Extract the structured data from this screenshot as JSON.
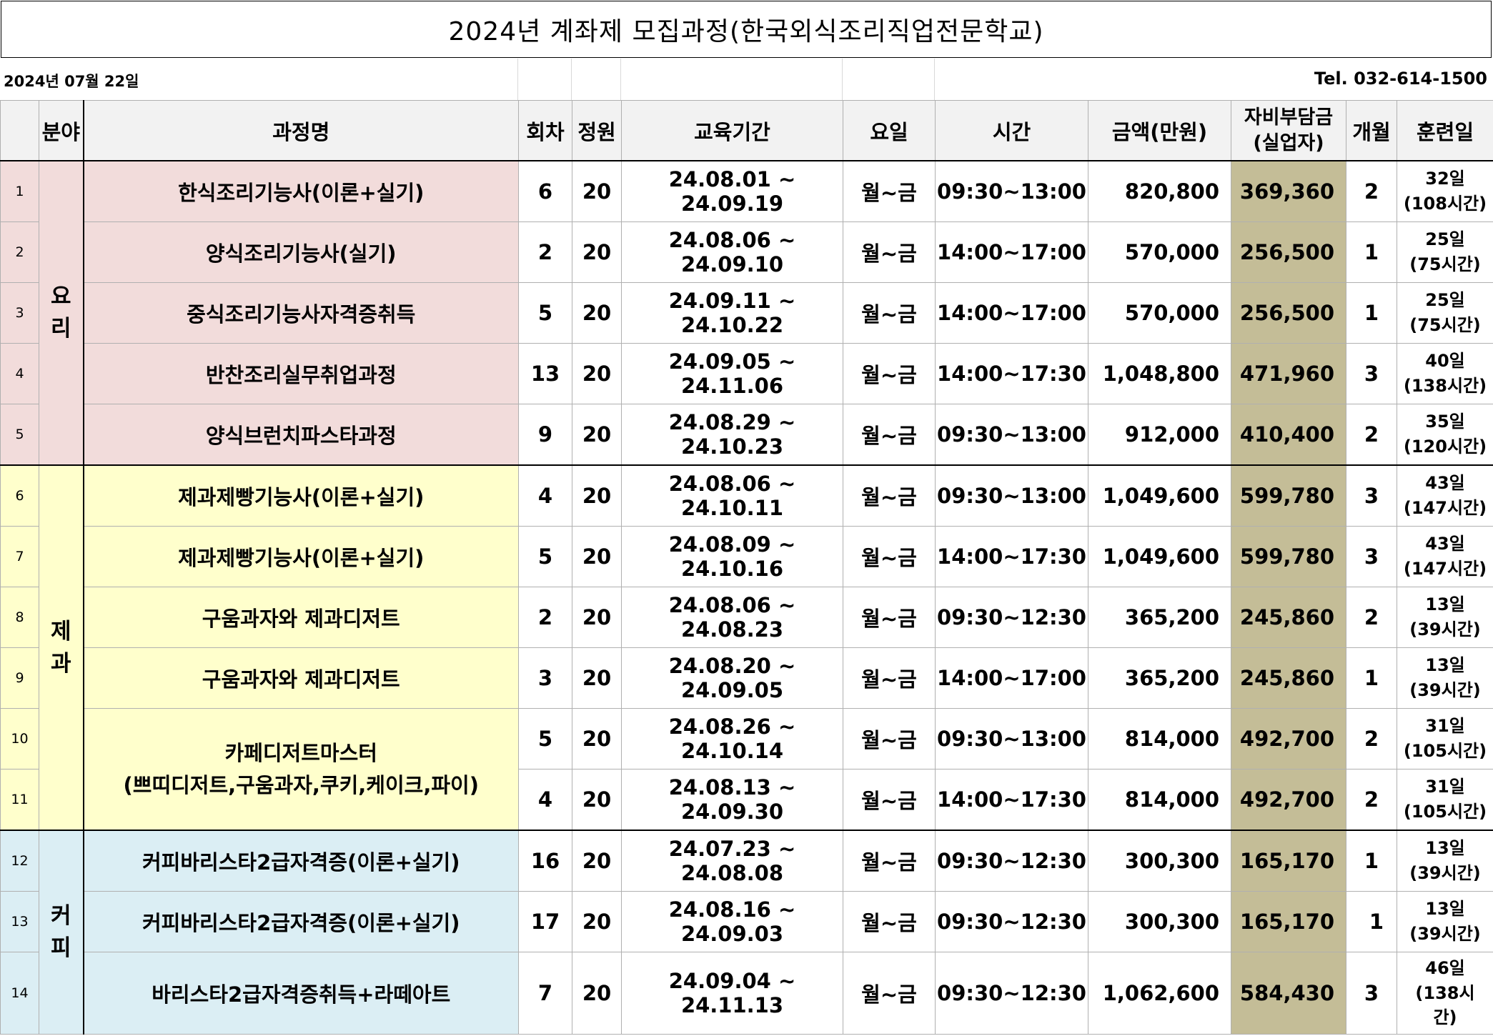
{
  "title": "2024년  계좌제  모집과정(한국외식조리직업전문학교)",
  "date": "2024년 07월 22일",
  "tel": "Tel.  032-614-1500",
  "headers": {
    "category": "분야",
    "course": "과정명",
    "round": "회차",
    "capacity": "정원",
    "period": "교육기간",
    "weekday": "요일",
    "time": "시간",
    "amount": "금액(만원)",
    "self_pay_1": "자비부담금",
    "self_pay_2": "(실업자)",
    "months": "개월",
    "training_days": "훈련일"
  },
  "categories": {
    "cooking": [
      "요",
      "리"
    ],
    "baking": [
      "제",
      "과"
    ],
    "coffee": [
      "커",
      "피"
    ]
  },
  "rows": [
    {
      "no": "1",
      "course": "한식조리기능사(이론+실기)",
      "round": "6",
      "capacity": "20",
      "period": "24.08.01 ~ 24.09.19",
      "weekday": "월~금",
      "time": "09:30~13:00",
      "amount": "820,800",
      "self": "369,360",
      "months": "2",
      "days1": "32일",
      "days2": "(108시간)"
    },
    {
      "no": "2",
      "course": "양식조리기능사(실기)",
      "round": "2",
      "capacity": "20",
      "period": "24.08.06 ~ 24.09.10",
      "weekday": "월~금",
      "time": "14:00~17:00",
      "amount": "570,000",
      "self": "256,500",
      "months": "1",
      "days1": "25일",
      "days2": "(75시간)"
    },
    {
      "no": "3",
      "course": "중식조리기능사자격증취득",
      "round": "5",
      "capacity": "20",
      "period": "24.09.11 ~ 24.10.22",
      "weekday": "월~금",
      "time": "14:00~17:00",
      "amount": "570,000",
      "self": "256,500",
      "months": "1",
      "days1": "25일",
      "days2": "(75시간)"
    },
    {
      "no": "4",
      "course": "반찬조리실무취업과정",
      "round": "13",
      "capacity": "20",
      "period": "24.09.05 ~ 24.11.06",
      "weekday": "월~금",
      "time": "14:00~17:30",
      "amount": "1,048,800",
      "self": "471,960",
      "months": "3",
      "days1": "40일",
      "days2": "(138시간)"
    },
    {
      "no": "5",
      "course": "양식브런치파스타과정",
      "round": "9",
      "capacity": "20",
      "period": "24.08.29 ~ 24.10.23",
      "weekday": "월~금",
      "time": "09:30~13:00",
      "amount": "912,000",
      "self": "410,400",
      "months": "2",
      "days1": "35일",
      "days2": "(120시간)"
    },
    {
      "no": "6",
      "course": "제과제빵기능사(이론+실기)",
      "round": "4",
      "capacity": "20",
      "period": "24.08.06 ~ 24.10.11",
      "weekday": "월~금",
      "time": "09:30~13:00",
      "amount": "1,049,600",
      "self": "599,780",
      "months": "3",
      "days1": "43일",
      "days2": "(147시간)"
    },
    {
      "no": "7",
      "course": "제과제빵기능사(이론+실기)",
      "round": "5",
      "capacity": "20",
      "period": "24.08.09 ~ 24.10.16",
      "weekday": "월~금",
      "time": "14:00~17:30",
      "amount": "1,049,600",
      "self": "599,780",
      "months": "3",
      "days1": "43일",
      "days2": "(147시간)"
    },
    {
      "no": "8",
      "course": "구움과자와 제과디저트",
      "round": "2",
      "capacity": "20",
      "period": "24.08.06 ~ 24.08.23",
      "weekday": "월~금",
      "time": "09:30~12:30",
      "amount": "365,200",
      "self": "245,860",
      "months": "2",
      "days1": "13일",
      "days2": "(39시간)"
    },
    {
      "no": "9",
      "course": "구움과자와 제과디저트",
      "round": "3",
      "capacity": "20",
      "period": "24.08.20 ~ 24.09.05",
      "weekday": "월~금",
      "time": "14:00~17:00",
      "amount": "365,200",
      "self": "245,860",
      "months": "1",
      "days1": "13일",
      "days2": "(39시간)"
    },
    {
      "no": "10",
      "course": "카페디저트마스터",
      "course2": "(쁘띠디저트,구움과자,쿠키,케이크,파이)",
      "round": "5",
      "capacity": "20",
      "period": "24.08.26 ~ 24.10.14",
      "weekday": "월~금",
      "time": "09:30~13:00",
      "amount": "814,000",
      "self": "492,700",
      "months": "2",
      "days1": "31일",
      "days2": "(105시간)"
    },
    {
      "no": "11",
      "round": "4",
      "capacity": "20",
      "period": "24.08.13 ~ 24.09.30",
      "weekday": "월~금",
      "time": "14:00~17:30",
      "amount": "814,000",
      "self": "492,700",
      "months": "2",
      "days1": "31일",
      "days2": "(105시간)"
    },
    {
      "no": "12",
      "course": "커피바리스타2급자격증(이론+실기)",
      "round": "16",
      "capacity": "20",
      "period": "24.07.23 ~ 24.08.08",
      "weekday": "월~금",
      "time": "09:30~12:30",
      "amount": "300,300",
      "self": "165,170",
      "months": "1",
      "days1": "13일",
      "days2": "(39시간)"
    },
    {
      "no": "13",
      "course": "커피바리스타2급자격증(이론+실기)",
      "round": "17",
      "capacity": "20",
      "period": "24.08.16 ~ 24.09.03",
      "weekday": "월~금",
      "time": "09:30~12:30",
      "amount": "300,300",
      "self": "165,170",
      "months": "1",
      "days1": "13일",
      "days2": "(39시간)"
    },
    {
      "no": "14",
      "course": "바리스타2급자격증취득+라떼아트",
      "round": "7",
      "capacity": "20",
      "period": "24.09.04 ~ 24.11.13",
      "weekday": "월~금",
      "time": "09:30~12:30",
      "amount": "1,062,600",
      "self": "584,430",
      "months": "3",
      "days1": "46일",
      "days2": "(138시",
      "days3": "간)"
    }
  ]
}
